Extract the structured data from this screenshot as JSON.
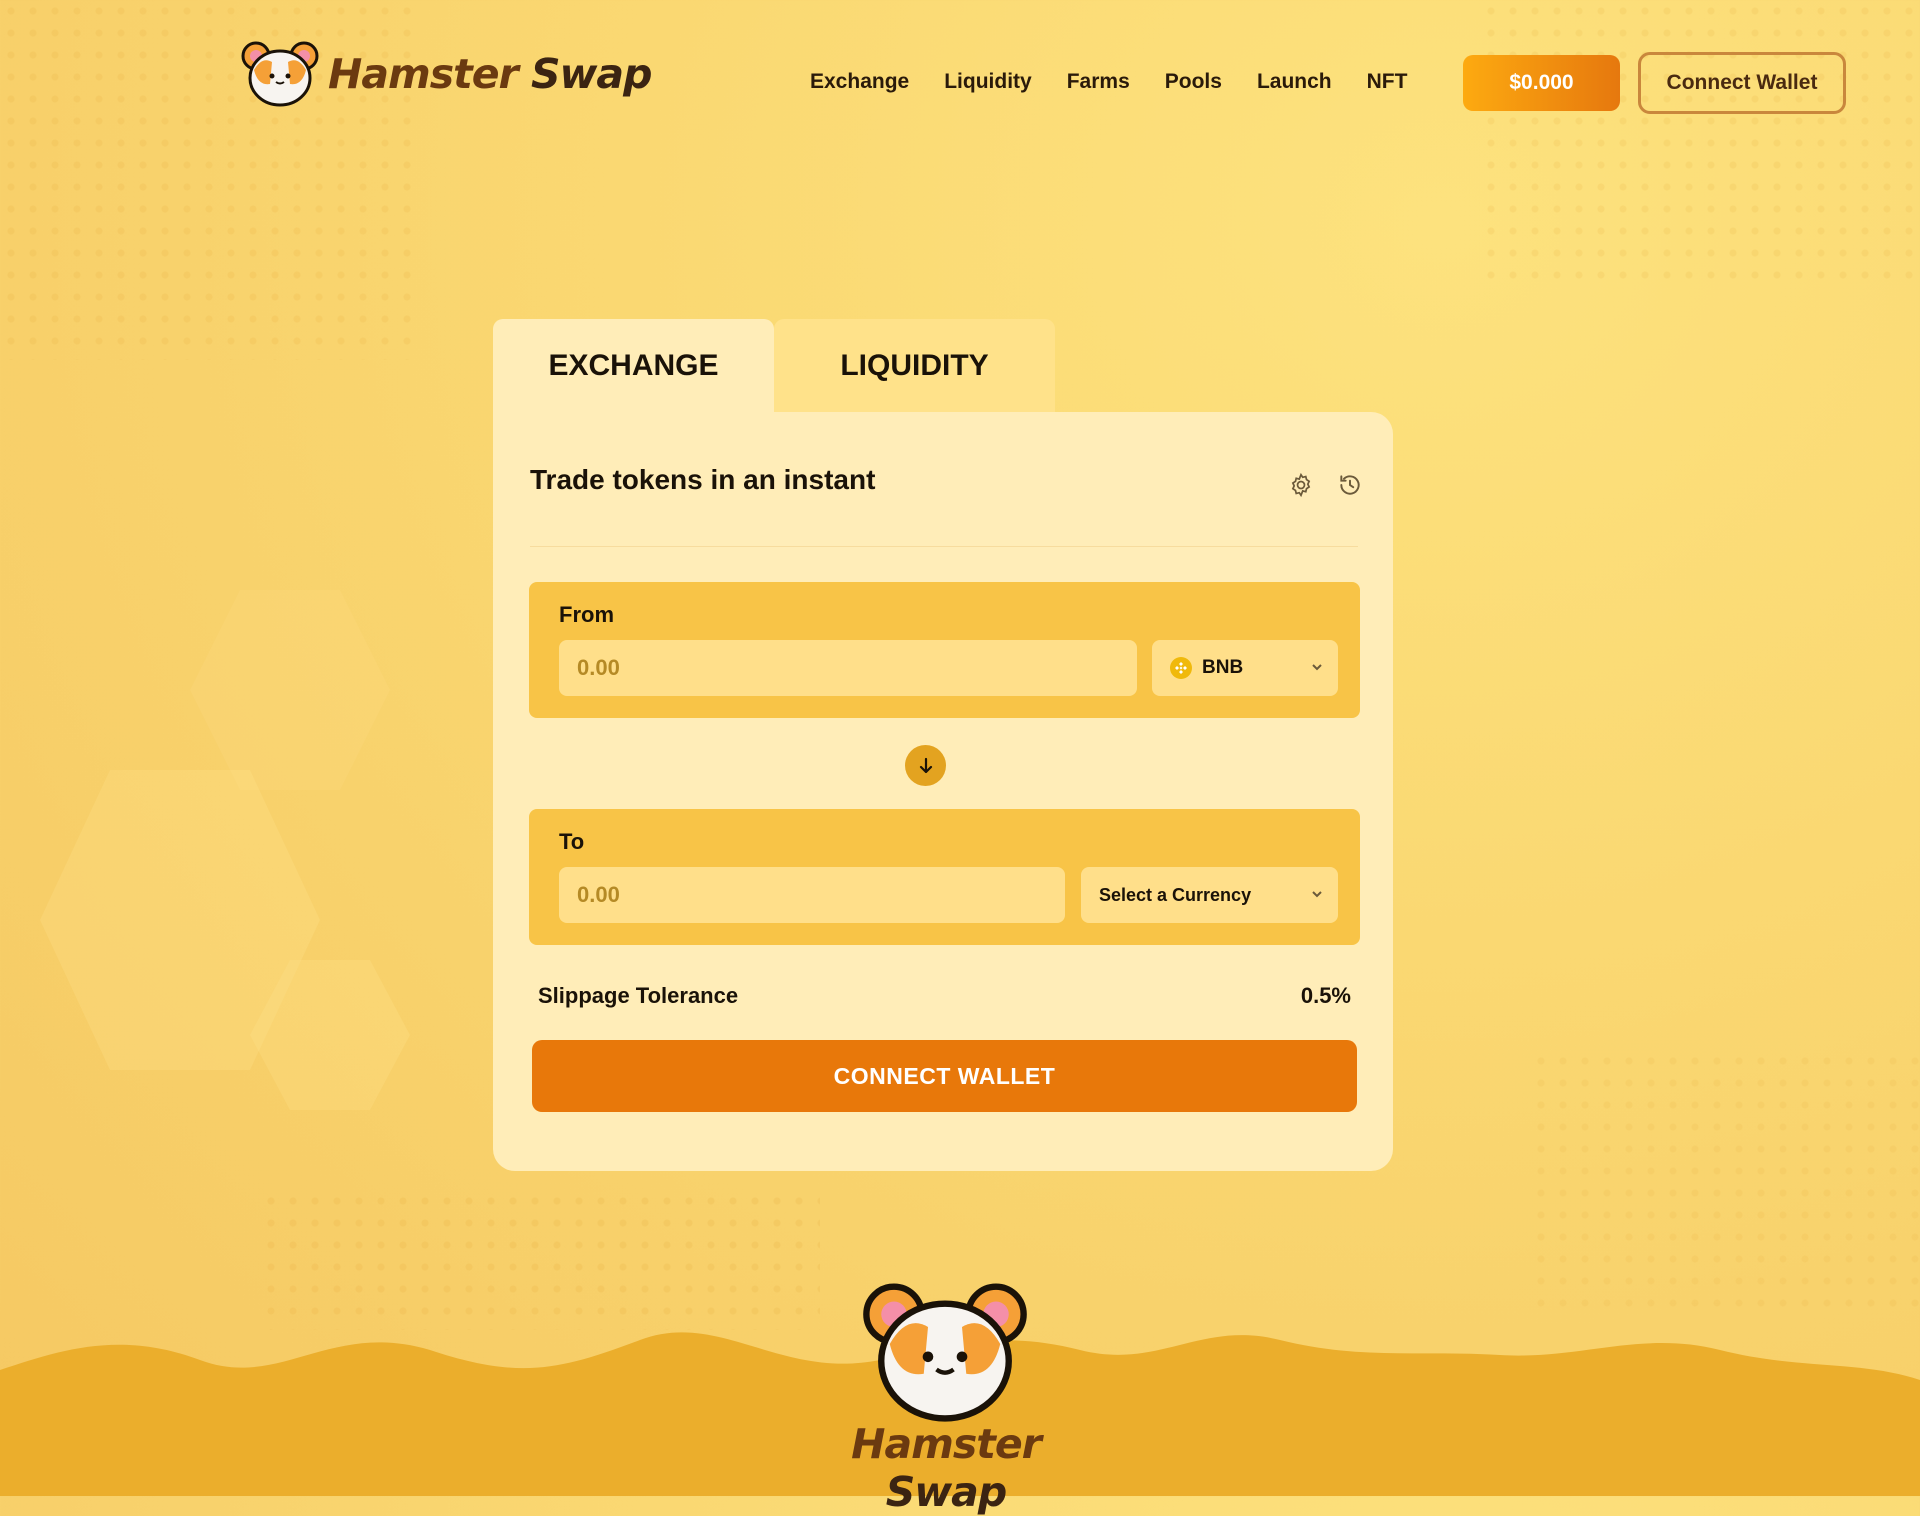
{
  "brand": {
    "name_part1": "Hamster",
    "name_part2": "Swap"
  },
  "nav": {
    "items": [
      "Exchange",
      "Liquidity",
      "Farms",
      "Pools",
      "Launch",
      "NFT"
    ],
    "price_label": "$0.000",
    "connect_label": "Connect Wallet"
  },
  "tabs": {
    "exchange": "EXCHANGE",
    "liquidity": "LIQUIDITY",
    "active": "EXCHANGE"
  },
  "card": {
    "title": "Trade tokens in an instant",
    "from": {
      "label": "From",
      "placeholder": "0.00",
      "token": "BNB"
    },
    "to": {
      "label": "To",
      "placeholder": "0.00",
      "token": "Select a Currency"
    },
    "slippage": {
      "label": "Slippage Tolerance",
      "value": "0.5%"
    },
    "connect_label": "CONNECT WALLET"
  },
  "footer": {
    "name_part1": "Hamster",
    "name_part2": "Swap"
  },
  "icons": [
    "hamster-logo-icon",
    "gear-icon",
    "history-icon",
    "chevron-down-icon",
    "bnb-icon",
    "arrow-down-icon"
  ],
  "colors": {
    "accent": "#e8780a",
    "panel": "#f8c447",
    "card": "#ffedb8",
    "input": "#ffdf8a",
    "brand_brown": "#6b3a10"
  }
}
